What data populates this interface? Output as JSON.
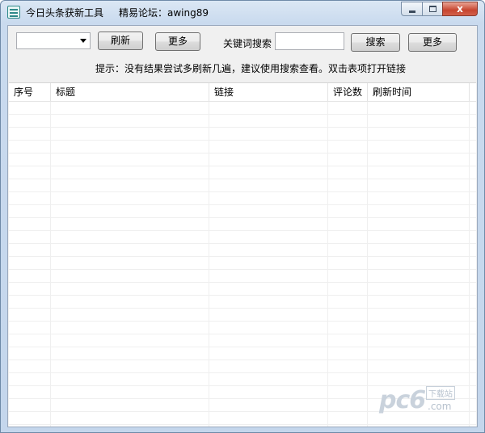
{
  "window": {
    "title": "今日头条获新工具",
    "forum": "精易论坛：awing89",
    "caption": {
      "minimize": "",
      "maximize": "",
      "close": "x"
    }
  },
  "toolbar": {
    "combo_value": "",
    "refresh_label": "刷新",
    "more_label_1": "更多",
    "keyword_label": "关键词搜索",
    "search_value": "",
    "search_label": "搜索",
    "more_label_2": "更多"
  },
  "hint": "提示：没有结果尝试多刷新几遍，建议使用搜索查看。双击表项打开链接",
  "table": {
    "columns": [
      "序号",
      "标题",
      "链接",
      "评论数",
      "刷新时间"
    ],
    "rows": []
  },
  "watermark": {
    "logo": "pc6",
    "cn": "下载站",
    "com": ".com"
  },
  "colors": {
    "title_gradient_top": "#dbe7f4",
    "close_button": "#c7452f",
    "client_bg": "#f0f0f0"
  }
}
